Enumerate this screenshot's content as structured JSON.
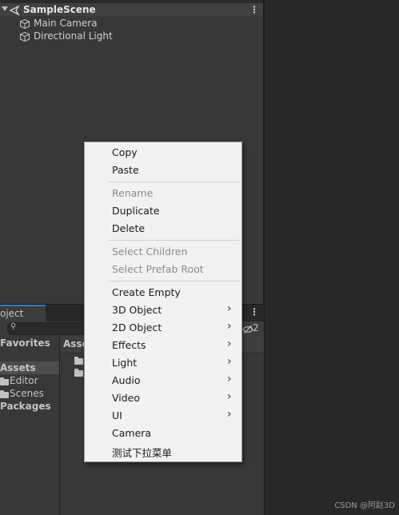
{
  "hierarchy": {
    "scene_name": "SampleScene",
    "objects": [
      "Main Camera",
      "Directional Light"
    ]
  },
  "project": {
    "tab_label": "oject",
    "hidden_count": "2",
    "tree": {
      "favorites": "Favorites",
      "assets": "Assets",
      "editor": "Editor",
      "scenes": "Scenes",
      "packages": "Packages"
    },
    "breadcrumb": "Asse"
  },
  "context_menu": {
    "copy": "Copy",
    "paste": "Paste",
    "rename": "Rename",
    "duplicate": "Duplicate",
    "delete": "Delete",
    "select_children": "Select Children",
    "select_prefab_root": "Select Prefab Root",
    "create_empty": "Create Empty",
    "object_3d": "3D Object",
    "object_2d": "2D Object",
    "effects": "Effects",
    "light": "Light",
    "audio": "Audio",
    "video": "Video",
    "ui": "UI",
    "camera": "Camera",
    "custom": "测试下拉菜单",
    "submenu_arrow": "›"
  },
  "watermark": "CSDN @阿赵3D",
  "colors": {
    "panel_bg": "#383838",
    "menu_bg": "#f2f2f2",
    "selection": "#4d4d4d",
    "tab_accent": "#3a79bb"
  }
}
